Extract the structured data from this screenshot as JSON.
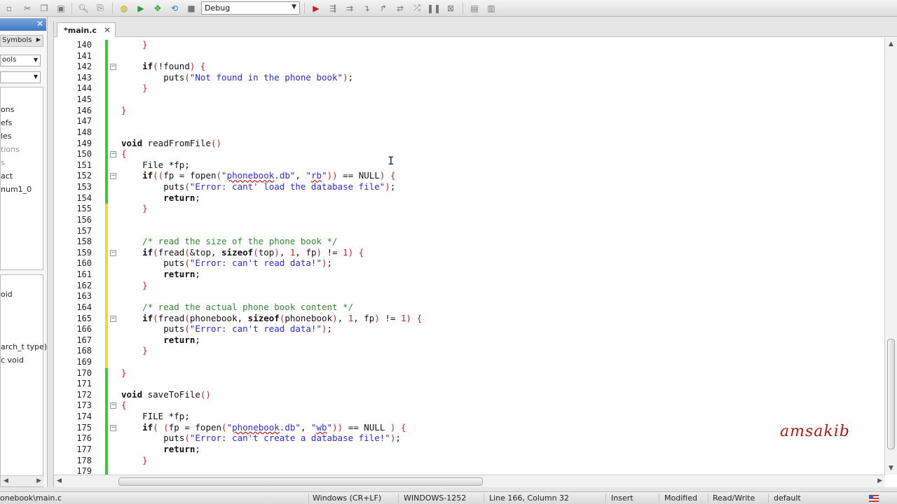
{
  "toolbar": {
    "config_select": "Debug",
    "icons": [
      "cut-icon",
      "copy-icon",
      "paste-icon",
      "find-icon",
      "replace-icon",
      "compile-icon",
      "run-icon",
      "build-run-icon",
      "rebuild-icon",
      "stop-icon",
      "debug-icon",
      "step-over-icon",
      "step-into-icon",
      "step-out-icon",
      "break-icon",
      "abort-icon",
      "window-icon",
      "options-icon"
    ]
  },
  "sidebar": {
    "tab_label": "Symbols",
    "combo1": "ools",
    "combo2": "",
    "items_top": [
      "ons",
      "efs",
      "les",
      "tions",
      "s",
      "act",
      "num1_0"
    ],
    "items_bottom": [
      "oid",
      "",
      "arch_t type)",
      "c void"
    ]
  },
  "editor": {
    "tab_label": "*main.c",
    "lines": [
      {
        "n": "140",
        "html": "    <span class=\"br\">}</span>"
      },
      {
        "n": "141",
        "html": ""
      },
      {
        "n": "142",
        "html": "    <span class=\"kw\">if</span><span class=\"br\">(</span>!found<span class=\"br\">)</span> <span class=\"br\">{</span>"
      },
      {
        "n": "143",
        "html": "        puts<span class=\"br\">(</span><span class=\"str\">\"Not found in the phone book\"</span><span class=\"br\">)</span>;"
      },
      {
        "n": "144",
        "html": "    <span class=\"br\">}</span>"
      },
      {
        "n": "145",
        "html": ""
      },
      {
        "n": "146",
        "html": "<span class=\"br\">}</span>"
      },
      {
        "n": "147",
        "html": ""
      },
      {
        "n": "148",
        "html": ""
      },
      {
        "n": "149",
        "html": "<span class=\"kw\">void</span> readFromFile<span class=\"br\">()</span>"
      },
      {
        "n": "150",
        "html": "<span class=\"br\">{</span>"
      },
      {
        "n": "151",
        "html": "    File *fp;"
      },
      {
        "n": "152",
        "html": "    <span class=\"kw\">if</span><span class=\"br\">((</span>fp = fopen<span class=\"br\">(</span><span class=\"str\">\"<span class=\"u\">phonebook</span>.db\"</span>, <span class=\"str\">\"<span class=\"u\">rb</span>\"</span><span class=\"br\">))</span> == NULL<span class=\"br\">)</span> <span class=\"br\">{</span>"
      },
      {
        "n": "153",
        "html": "        puts<span class=\"br\">(</span><span class=\"str\">\"Error: cant' load the database file\"</span><span class=\"br\">)</span>;"
      },
      {
        "n": "154",
        "html": "        <span class=\"kw\">return</span>;"
      },
      {
        "n": "155",
        "html": "    <span class=\"br\">}</span>"
      },
      {
        "n": "156",
        "html": ""
      },
      {
        "n": "157",
        "html": ""
      },
      {
        "n": "158",
        "html": "    <span class=\"cmt\">/* read the size of the phone book */</span>"
      },
      {
        "n": "159",
        "html": "    <span class=\"kw\">if</span><span class=\"br\">(</span>fread<span class=\"br\">(</span>&amp;top, <span class=\"kw\">sizeof</span><span class=\"br\">(</span>top<span class=\"br\">)</span>, <span class=\"br\">1</span>, fp<span class=\"br\">)</span> != <span class=\"br\">1</span><span class=\"br\">)</span> <span class=\"br\">{</span>"
      },
      {
        "n": "160",
        "html": "        puts<span class=\"br\">(</span><span class=\"str\">\"Error: can't read data!\"</span><span class=\"br\">)</span>;"
      },
      {
        "n": "161",
        "html": "        <span class=\"kw\">return</span>;"
      },
      {
        "n": "162",
        "html": "    <span class=\"br\">}</span>"
      },
      {
        "n": "163",
        "html": ""
      },
      {
        "n": "164",
        "html": "    <span class=\"cmt\">/* read the actual phone book content */</span>"
      },
      {
        "n": "165",
        "html": "    <span class=\"kw\">if</span><span class=\"br\">(</span>fread<span class=\"br\">(</span>phonebook, <span class=\"kw\">sizeof</span><span class=\"br\">(</span>phonebook<span class=\"br\">)</span>, <span class=\"br\">1</span>, fp<span class=\"br\">)</span> != <span class=\"br\">1</span><span class=\"br\">)</span> <span class=\"br\">{</span>"
      },
      {
        "n": "166",
        "html": "        puts<span class=\"br\">(</span><span class=\"str\">\"Error: can't read data!\"</span><span class=\"br\">)</span>;"
      },
      {
        "n": "167",
        "html": "        <span class=\"kw\">return</span>;"
      },
      {
        "n": "168",
        "html": "    <span class=\"br\">}</span>"
      },
      {
        "n": "169",
        "html": ""
      },
      {
        "n": "170",
        "html": "<span class=\"br\">}</span>"
      },
      {
        "n": "171",
        "html": ""
      },
      {
        "n": "172",
        "html": "<span class=\"kw\">void</span> saveToFile<span class=\"br\">()</span>"
      },
      {
        "n": "173",
        "html": "<span class=\"br\">{</span>"
      },
      {
        "n": "174",
        "html": "    FILE *fp;"
      },
      {
        "n": "175",
        "html": "    <span class=\"kw\">if</span><span class=\"br\">(</span> <span class=\"br\">(</span>fp = fopen<span class=\"br\">(</span><span class=\"str\">\"<span class=\"u\">phonebook</span>.db\"</span>, <span class=\"str\">\"<span class=\"u\">wb</span>\"</span><span class=\"br\">))</span> == NULL <span class=\"br\">)</span> <span class=\"br\">{</span>"
      },
      {
        "n": "176",
        "html": "        puts<span class=\"br\">(</span><span class=\"str\">\"Error: can't create a database file!\"</span><span class=\"br\">)</span>;"
      },
      {
        "n": "177",
        "html": "        <span class=\"kw\">return</span>;"
      },
      {
        "n": "178",
        "html": "    <span class=\"br\">}</span>"
      },
      {
        "n": "179",
        "html": ""
      }
    ]
  },
  "watermark": "amsakib",
  "statusbar": {
    "path": "onebook\\main.c",
    "line_ending": "Windows (CR+LF)",
    "encoding": "WINDOWS-1252",
    "position": "Line 166, Column 32",
    "mode": "Insert",
    "modified": "Modified",
    "access": "Read/Write",
    "profile": "default"
  },
  "colors": {
    "keyword": "#111111",
    "string": "#2a2adb",
    "comment": "#2f8a2f",
    "bracket": "#d42020",
    "changebar_saved": "#3cc83c",
    "changebar_modified": "#e8d848"
  }
}
